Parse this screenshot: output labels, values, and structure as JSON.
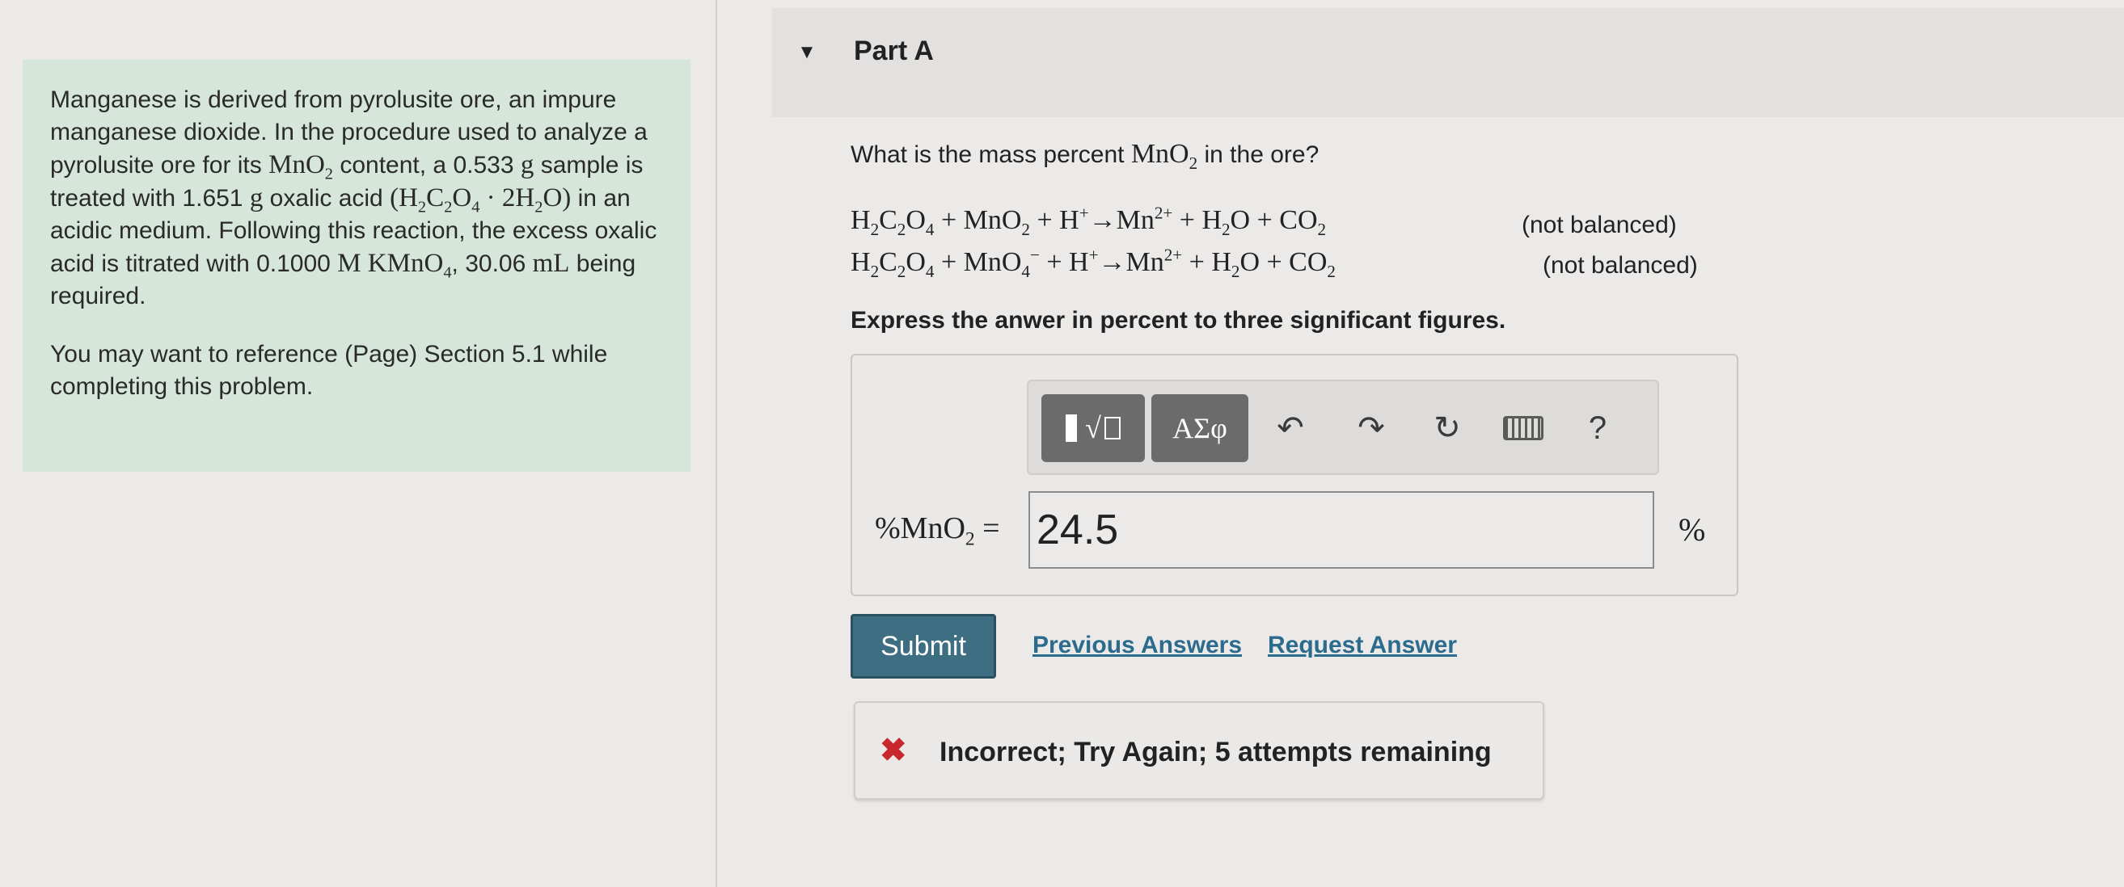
{
  "problem": {
    "p1_a": "Manganese is derived from pyrolusite ore, an impure manganese dioxide. In the procedure used to analyze a pyrolusite ore for its ",
    "p1_mno2": "MnO",
    "p1_b": " content, a 0.533 ",
    "p1_g1": "g",
    "p1_c": " sample is treated with 1.651 ",
    "p1_g2": "g",
    "p1_d": " oxalic acid ",
    "p1_e": " in an acidic medium. Following this reaction, the excess oxalic acid is titrated with 0.1000 ",
    "p1_m": "M KMnO",
    "p1_f": ", 30.06 ",
    "p1_ml": "mL",
    "p1_g": " being required.",
    "p2": "You may want to reference (Page) Section 5.1 while completing this problem."
  },
  "part": {
    "title": "Part A"
  },
  "question": {
    "text_a": "What is the mass percent ",
    "text_b": " in the ore?",
    "note1": "(not balanced)",
    "note2": "(not balanced)",
    "instruction": "Express the anwer in percent to three significant figures."
  },
  "toolbar": {
    "template_label": "√",
    "greek_label": "ΑΣφ",
    "help_label": "?"
  },
  "answer": {
    "value": "24.5",
    "unit": "%"
  },
  "actions": {
    "submit": "Submit",
    "previous_answers": "Previous Answers",
    "request_answer": "Request Answer"
  },
  "feedback": {
    "text": "Incorrect; Try Again; 5 attempts remaining",
    "icon": "x-icon",
    "color": "#c8282d"
  }
}
